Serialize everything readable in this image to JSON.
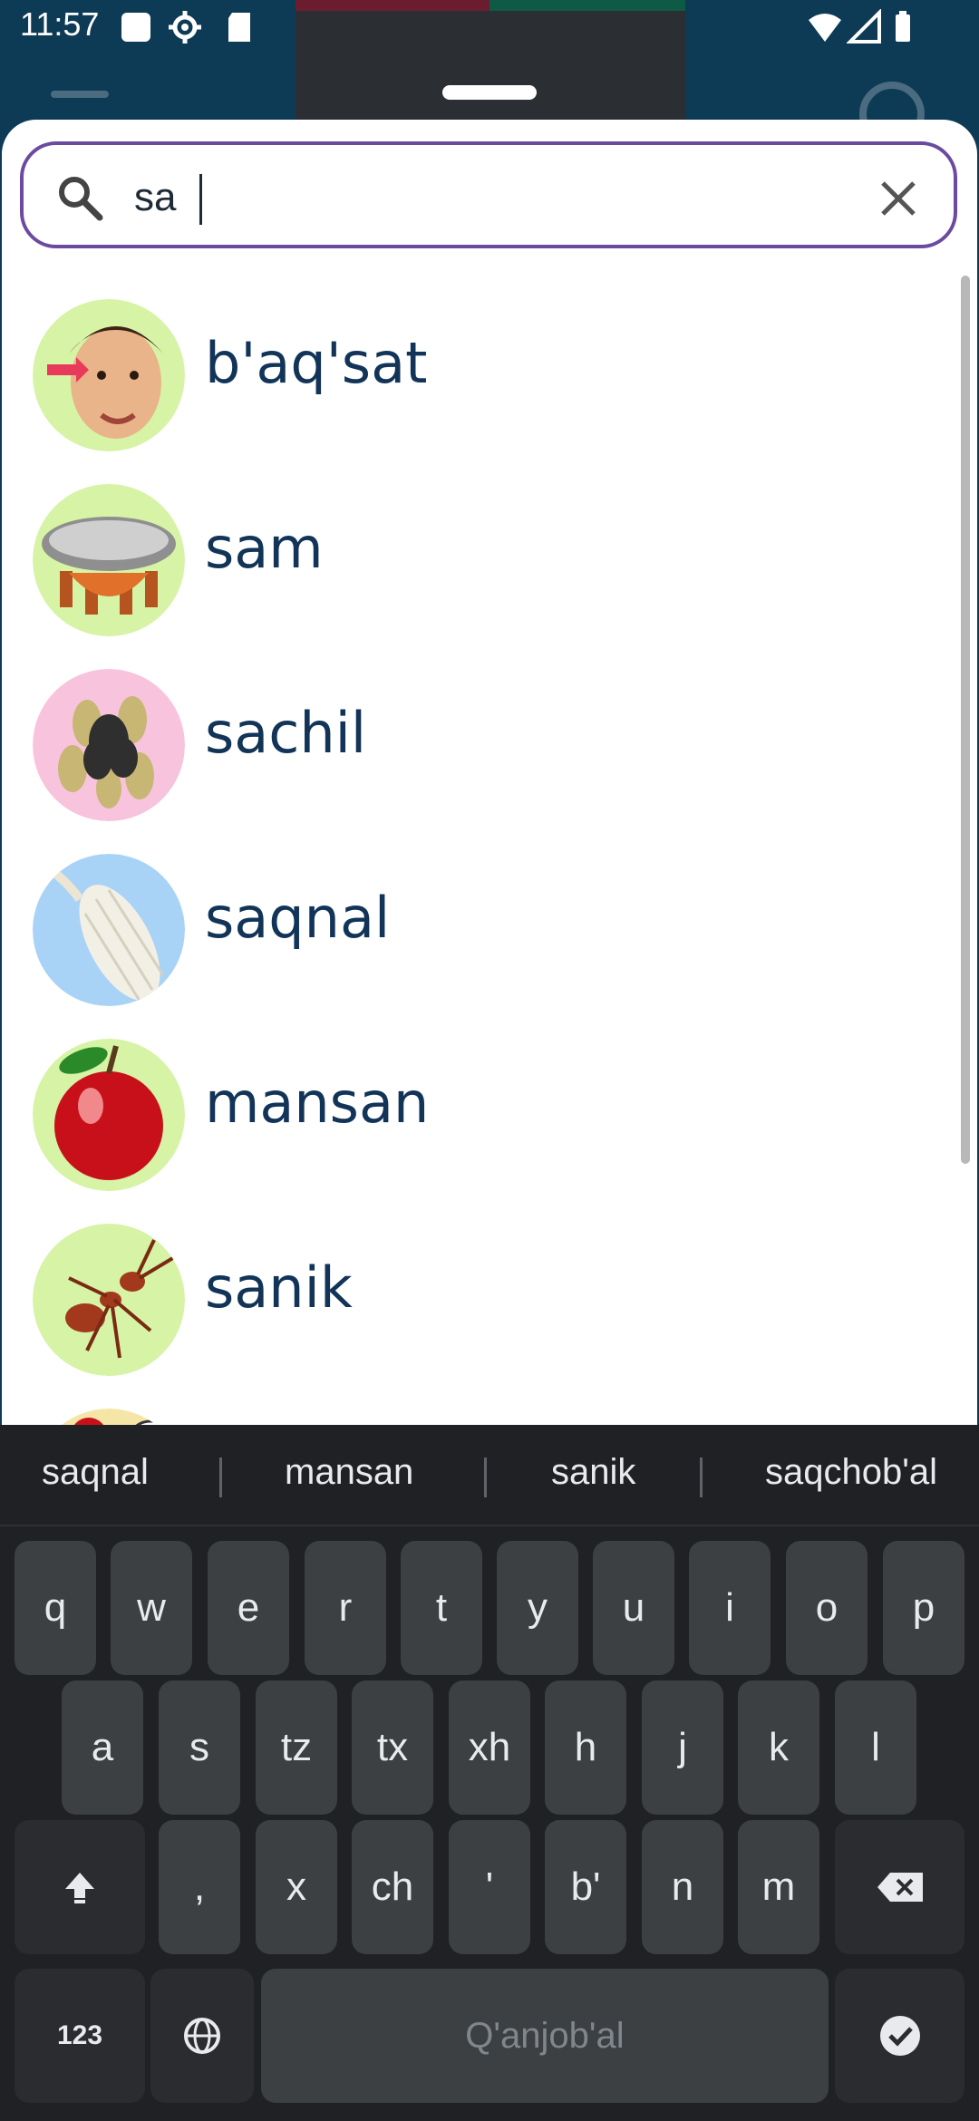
{
  "status_bar": {
    "time": "11:57"
  },
  "search": {
    "value": "sa"
  },
  "results": [
    {
      "word": "b'aq'sat"
    },
    {
      "word": "sam"
    },
    {
      "word": "sachil"
    },
    {
      "word": "saqnal"
    },
    {
      "word": "mansan"
    },
    {
      "word": "sanik"
    }
  ],
  "keyboard": {
    "suggestions": [
      "saqnal",
      "mansan",
      "sanik",
      "saqchob'al"
    ],
    "row1": [
      "q",
      "w",
      "e",
      "r",
      "t",
      "y",
      "u",
      "i",
      "o",
      "p"
    ],
    "row2": [
      "a",
      "s",
      "tz",
      "tx",
      "xh",
      "h",
      "j",
      "k",
      "l"
    ],
    "row3": [
      ",",
      "x",
      "ch",
      "'",
      "b'",
      "n",
      "m"
    ],
    "numbers_label": "123",
    "space_label": "Q'anjob'al"
  },
  "colors": {
    "accent": "#6b4aa0",
    "word_text": "#123458",
    "app_bar": "#0d3a55",
    "keyboard_bg": "#202124",
    "key_bg": "#3c4043"
  }
}
